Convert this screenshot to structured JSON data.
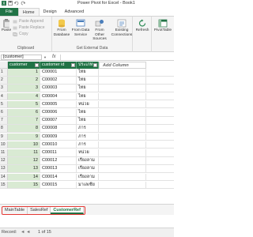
{
  "app": {
    "title": "Power Pivot for Excel - Book1"
  },
  "ribbon": {
    "tabs": [
      {
        "label": "File"
      },
      {
        "label": "Home"
      },
      {
        "label": "Design"
      },
      {
        "label": "Advanced"
      }
    ],
    "clipboard": {
      "label": "Clipboard",
      "paste": "Paste",
      "paste_append": "Paste Append",
      "paste_replace": "Paste Replace",
      "copy": "Copy"
    },
    "external": {
      "label": "Get External Data",
      "from_database": "From Database",
      "from_data_service": "From Data Service",
      "from_other_sources": "From Other Sources",
      "existing_connections": "Existing Connections"
    },
    "refresh": "Refresh",
    "pivottable": "PivotTable"
  },
  "formula_bar": {
    "name_box": "[customer]",
    "fx": "fx"
  },
  "table": {
    "columns": [
      "customer",
      "customer id",
      "ประเภท",
      "Add Column"
    ],
    "rows": [
      {
        "n": "1",
        "customer": "1",
        "id": "C00001",
        "type": "ไทย"
      },
      {
        "n": "2",
        "customer": "2",
        "id": "C00002",
        "type": "ไทย"
      },
      {
        "n": "3",
        "customer": "3",
        "id": "C00003",
        "type": "ไทย"
      },
      {
        "n": "4",
        "customer": "4",
        "id": "C00004",
        "type": "ไทย"
      },
      {
        "n": "5",
        "customer": "5",
        "id": "C00005",
        "type": "หน่วย"
      },
      {
        "n": "6",
        "customer": "6",
        "id": "C00006",
        "type": "ไทย"
      },
      {
        "n": "7",
        "customer": "7",
        "id": "C00007",
        "type": "ไทย"
      },
      {
        "n": "8",
        "customer": "8",
        "id": "C00008",
        "type": "ภาร"
      },
      {
        "n": "9",
        "customer": "9",
        "id": "C00009",
        "type": "ภาร"
      },
      {
        "n": "10",
        "customer": "10",
        "id": "C00010",
        "type": "ภาร"
      },
      {
        "n": "11",
        "customer": "11",
        "id": "C00011",
        "type": "หน่วย"
      },
      {
        "n": "12",
        "customer": "12",
        "id": "C00012",
        "type": "เรียงลาม"
      },
      {
        "n": "13",
        "customer": "13",
        "id": "C00013",
        "type": "เรียงลาม"
      },
      {
        "n": "14",
        "customer": "14",
        "id": "C00014",
        "type": "เรียงลาม"
      },
      {
        "n": "15",
        "customer": "15",
        "id": "C00015",
        "type": "มาเลเซีย"
      }
    ]
  },
  "sheets": [
    {
      "label": "MainTable"
    },
    {
      "label": "SalesRef"
    },
    {
      "label": "CustomerRef"
    }
  ],
  "status": {
    "record_label": "Record:",
    "nav": "◄ ◄",
    "position": "1 of 15"
  },
  "colors": {
    "excel_green": "#217346",
    "highlight_border": "#e53935"
  }
}
